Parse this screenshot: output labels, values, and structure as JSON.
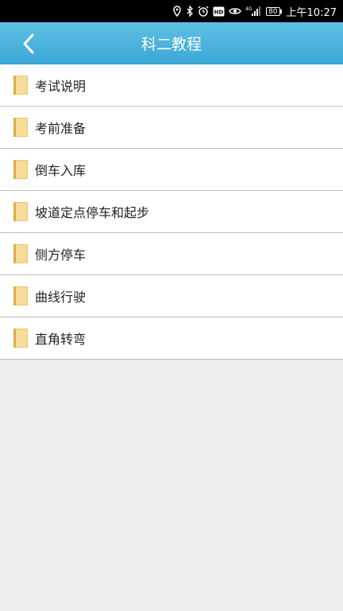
{
  "status_bar": {
    "battery": "80",
    "time": "上午10:27",
    "icons": [
      "location-icon",
      "bluetooth-icon",
      "alarm-icon",
      "hd-icon",
      "eye-icon",
      "signal-icon",
      "battery-icon"
    ]
  },
  "header": {
    "title": "科二教程",
    "back_icon": "chevron-left-icon"
  },
  "list": {
    "items": [
      {
        "label": "考试说明",
        "icon": "folder-icon"
      },
      {
        "label": "考前准备",
        "icon": "folder-icon"
      },
      {
        "label": "倒车入库",
        "icon": "folder-icon"
      },
      {
        "label": "坡道定点停车和起步",
        "icon": "folder-icon"
      },
      {
        "label": "侧方停车",
        "icon": "folder-icon"
      },
      {
        "label": "曲线行驶",
        "icon": "folder-icon"
      },
      {
        "label": "直角转弯",
        "icon": "folder-icon"
      }
    ]
  },
  "colors": {
    "header": "#4db4dd",
    "status_bar": "#000000",
    "background": "#eeeeee",
    "folder": "#e8c46a"
  }
}
